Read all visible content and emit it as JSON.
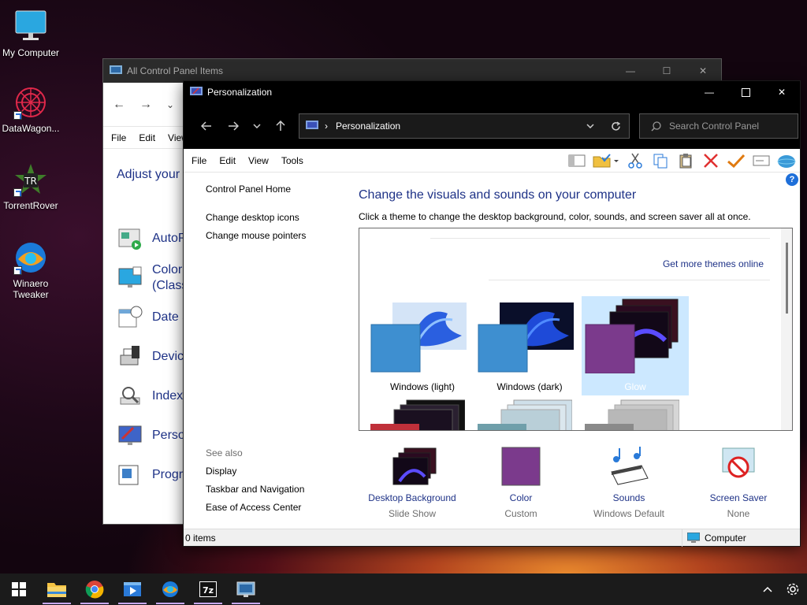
{
  "desktop": {
    "icons": [
      {
        "label": "My Computer"
      },
      {
        "label": "DataWagon..."
      },
      {
        "label": "TorrentRover"
      },
      {
        "label": "Winaero Tweaker"
      }
    ]
  },
  "background_window": {
    "title": "All Control Panel Items",
    "menu": [
      "File",
      "Edit",
      "View"
    ],
    "heading": "Adjust your",
    "items": [
      "AutoP",
      "Color (Class",
      "Date a",
      "Device",
      "Indexi",
      "Perso",
      "Progr"
    ]
  },
  "window": {
    "title": "Personalization",
    "address": {
      "crumb": "Personalization"
    },
    "search": {
      "placeholder": "Search Control Panel"
    },
    "menu": [
      "File",
      "Edit",
      "View",
      "Tools"
    ],
    "sidebar": {
      "home": "Control Panel Home",
      "links": [
        "Change desktop icons",
        "Change mouse pointers"
      ],
      "see_also_label": "See also",
      "see_also": [
        "Display",
        "Taskbar and Navigation",
        "Ease of Access Center"
      ]
    },
    "main": {
      "title": "Change the visuals and sounds on your computer",
      "description": "Click a theme to change the desktop background, color, sounds, and screen saver all at once.",
      "more_themes": "Get more themes online",
      "themes": [
        {
          "label": "Windows (light)",
          "selected": false
        },
        {
          "label": "Windows (dark)",
          "selected": false
        },
        {
          "label": "Glow",
          "selected": true
        }
      ]
    },
    "bottom": [
      {
        "label": "Desktop Background",
        "sub": "Slide Show"
      },
      {
        "label": "Color",
        "sub": "Custom"
      },
      {
        "label": "Sounds",
        "sub": "Windows Default"
      },
      {
        "label": "Screen Saver",
        "sub": "None"
      }
    ],
    "status": {
      "left": "0 items",
      "right": "Computer"
    }
  },
  "colors": {
    "accent_link": "#1e3287",
    "selection": "#cce8ff",
    "theme_color": "#7b3a8c"
  }
}
